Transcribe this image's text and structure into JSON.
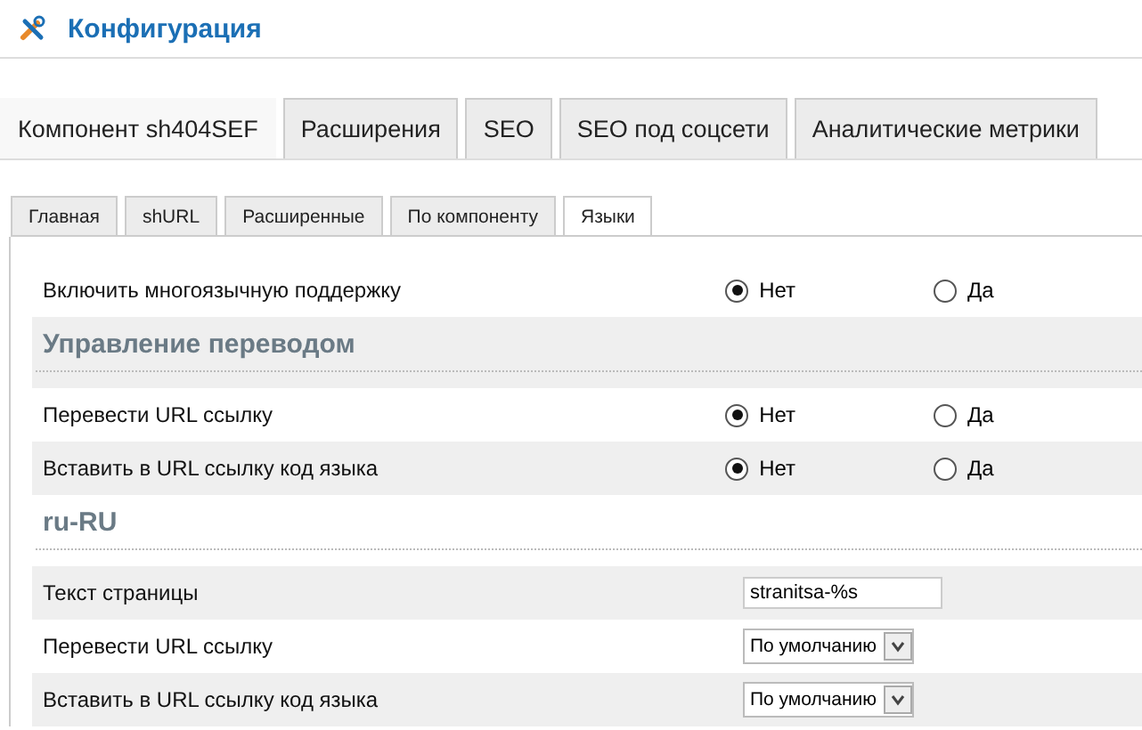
{
  "header": {
    "title": "Конфигурация"
  },
  "tabs": [
    {
      "label": "Компонент sh404SEF",
      "selected": true
    },
    {
      "label": "Расширения",
      "selected": false
    },
    {
      "label": "SEO",
      "selected": false
    },
    {
      "label": "SEO под соцсети",
      "selected": false
    },
    {
      "label": "Аналитические метрики",
      "selected": false
    }
  ],
  "subtabs": [
    {
      "label": "Главная",
      "selected": false
    },
    {
      "label": "shURL",
      "selected": false
    },
    {
      "label": "Расширенные",
      "selected": false
    },
    {
      "label": "По компоненту",
      "selected": false
    },
    {
      "label": "Языки",
      "selected": true
    }
  ],
  "items": [
    {
      "kind": "radio",
      "label": "Включить многоязычную поддержку",
      "options": [
        {
          "label": "Нет",
          "selected": true
        },
        {
          "label": "Да",
          "selected": false
        }
      ]
    },
    {
      "kind": "heading",
      "label": "Управление переводом"
    },
    {
      "kind": "radio",
      "label": "Перевести URL ссылку",
      "options": [
        {
          "label": "Нет",
          "selected": true
        },
        {
          "label": "Да",
          "selected": false
        }
      ]
    },
    {
      "kind": "radio",
      "label": "Вставить в URL ссылку код языка",
      "options": [
        {
          "label": "Нет",
          "selected": true
        },
        {
          "label": "Да",
          "selected": false
        }
      ]
    },
    {
      "kind": "heading",
      "label": "ru-RU"
    },
    {
      "kind": "text",
      "label": "Текст страницы",
      "value": "stranitsa-%s"
    },
    {
      "kind": "select",
      "label": "Перевести URL ссылку",
      "value": "По умолчанию"
    },
    {
      "kind": "select",
      "label": "Вставить в URL ссылку код языка",
      "value": "По умолчанию"
    }
  ]
}
